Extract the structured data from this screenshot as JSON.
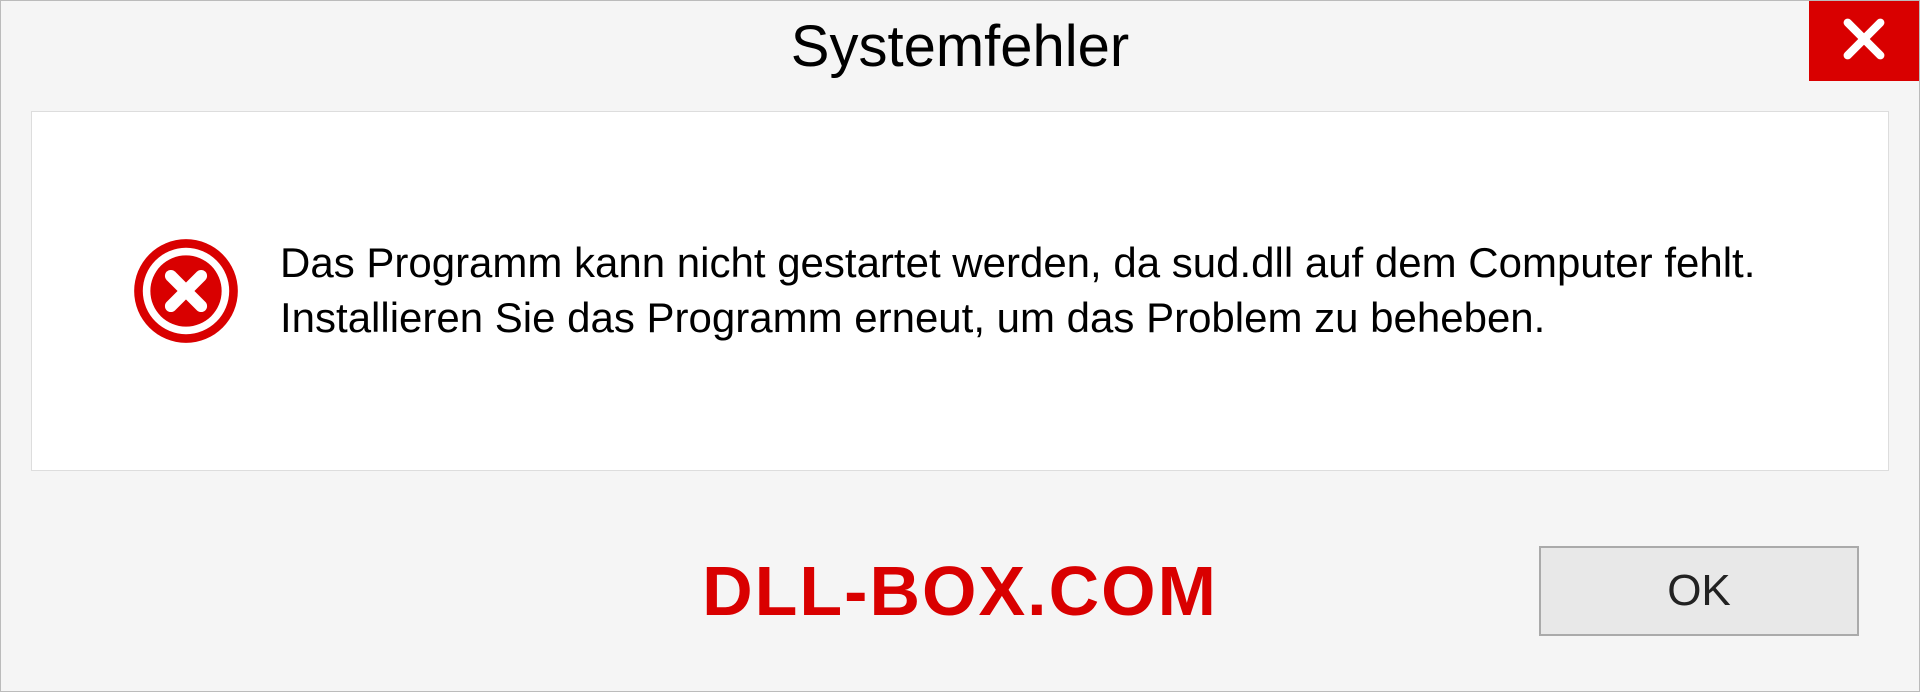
{
  "dialog": {
    "title": "Systemfehler",
    "message": "Das Programm kann nicht gestartet werden, da sud.dll auf dem Computer fehlt. Installieren Sie das Programm erneut, um das Problem zu beheben.",
    "ok_label": "OK"
  },
  "watermark": "DLL-BOX.COM",
  "colors": {
    "close_button": "#d90000",
    "error_icon": "#d90000",
    "watermark": "#d90000"
  }
}
